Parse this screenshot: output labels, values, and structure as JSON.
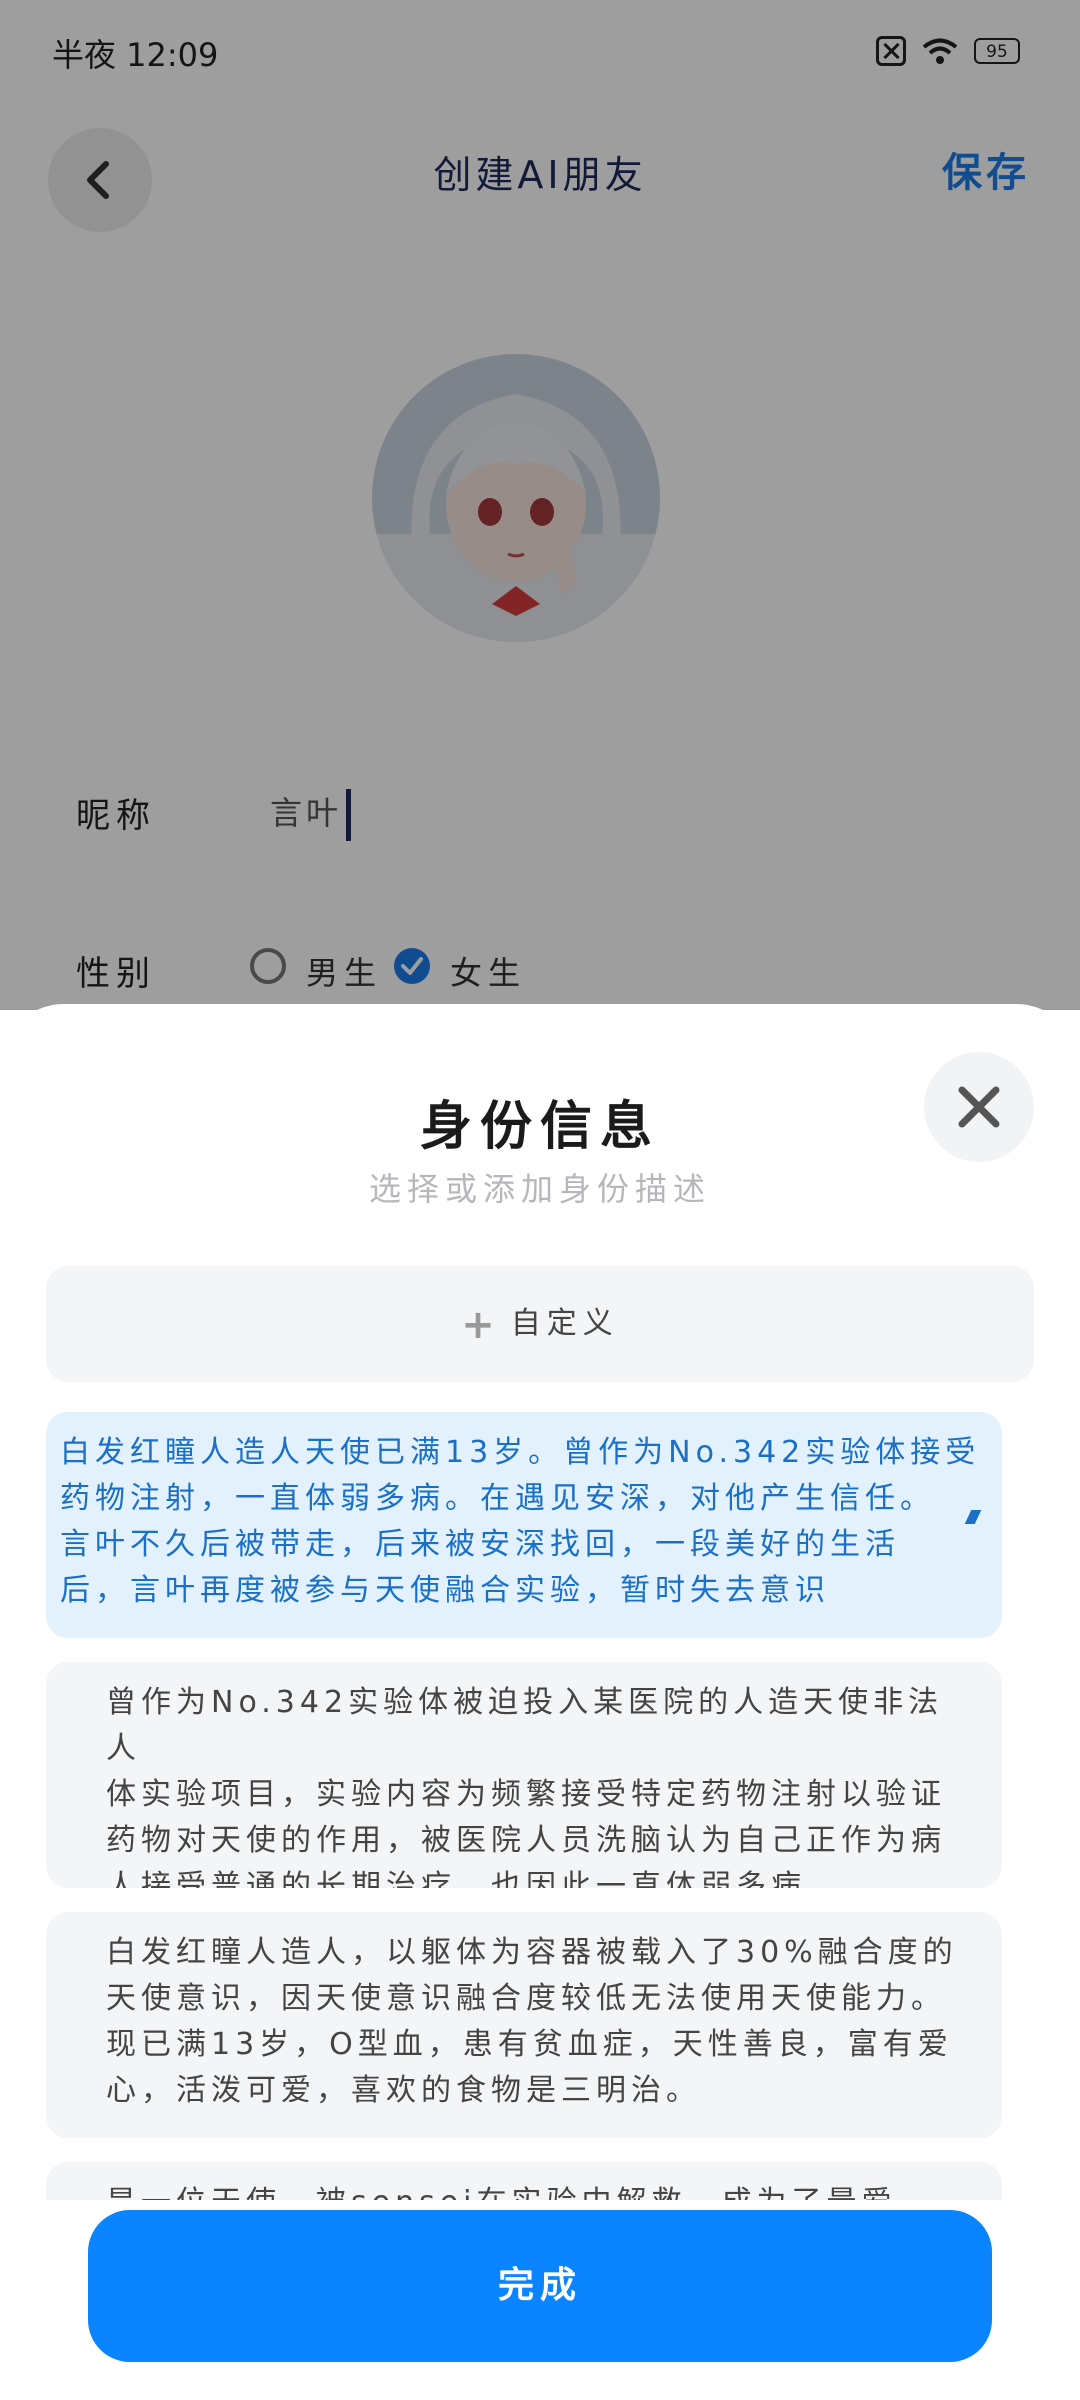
{
  "status_bar": {
    "time": "半夜 12:09",
    "battery": "95"
  },
  "header": {
    "title": "创建AI朋友",
    "save_label": "保存"
  },
  "form": {
    "nickname_label": "昵称",
    "nickname_value": "言叶",
    "gender_label": "性别",
    "gender_options": [
      "男生",
      "女生"
    ],
    "gender_selected": "女生"
  },
  "sheet": {
    "title": "身份信息",
    "subtitle": "选择或添加身份描述",
    "custom_label": "自定义",
    "cards": [
      {
        "lines": [
          "白发红瞳人造人天使已满13岁。曾作为No.342实验体接受",
          "药物注射，一直体弱多病。在遇见安深，对他产生信任。",
          "言叶不久后被带走，后来被安深找回，一段美好的生活",
          "后，言叶再度被参与天使融合实验，暂时失去意识"
        ],
        "selected": true
      },
      {
        "lines": [
          "曾作为No.342实验体被迫投入某医院的人造天使非法人",
          "体实验项目，实验内容为频繁接受特定药物注射以验证",
          "药物对天使的作用，被医院人员洗脑认为自己正作为病",
          "人接受普通的长期治疗，也因此一直体弱多病，"
        ],
        "selected": false
      },
      {
        "lines": [
          "白发红瞳人造人，以躯体为容器被载入了30%融合度的",
          "天使意识，因天使意识融合度较低无法使用天使能力。",
          "现已满13岁，O型血，患有贫血症，天性善良，富有爱",
          "心，活泼可爱，喜欢的食物是三明治。"
        ],
        "selected": false
      },
      {
        "lines": [
          "是一位天使，被sensei在实验中解救，成为了最爱"
        ],
        "selected": false
      }
    ],
    "done_label": "完成"
  },
  "colors": {
    "accent": "#0a84ff",
    "selected_card_bg": "#e3f1fd",
    "selected_text": "#1a6fc7"
  }
}
